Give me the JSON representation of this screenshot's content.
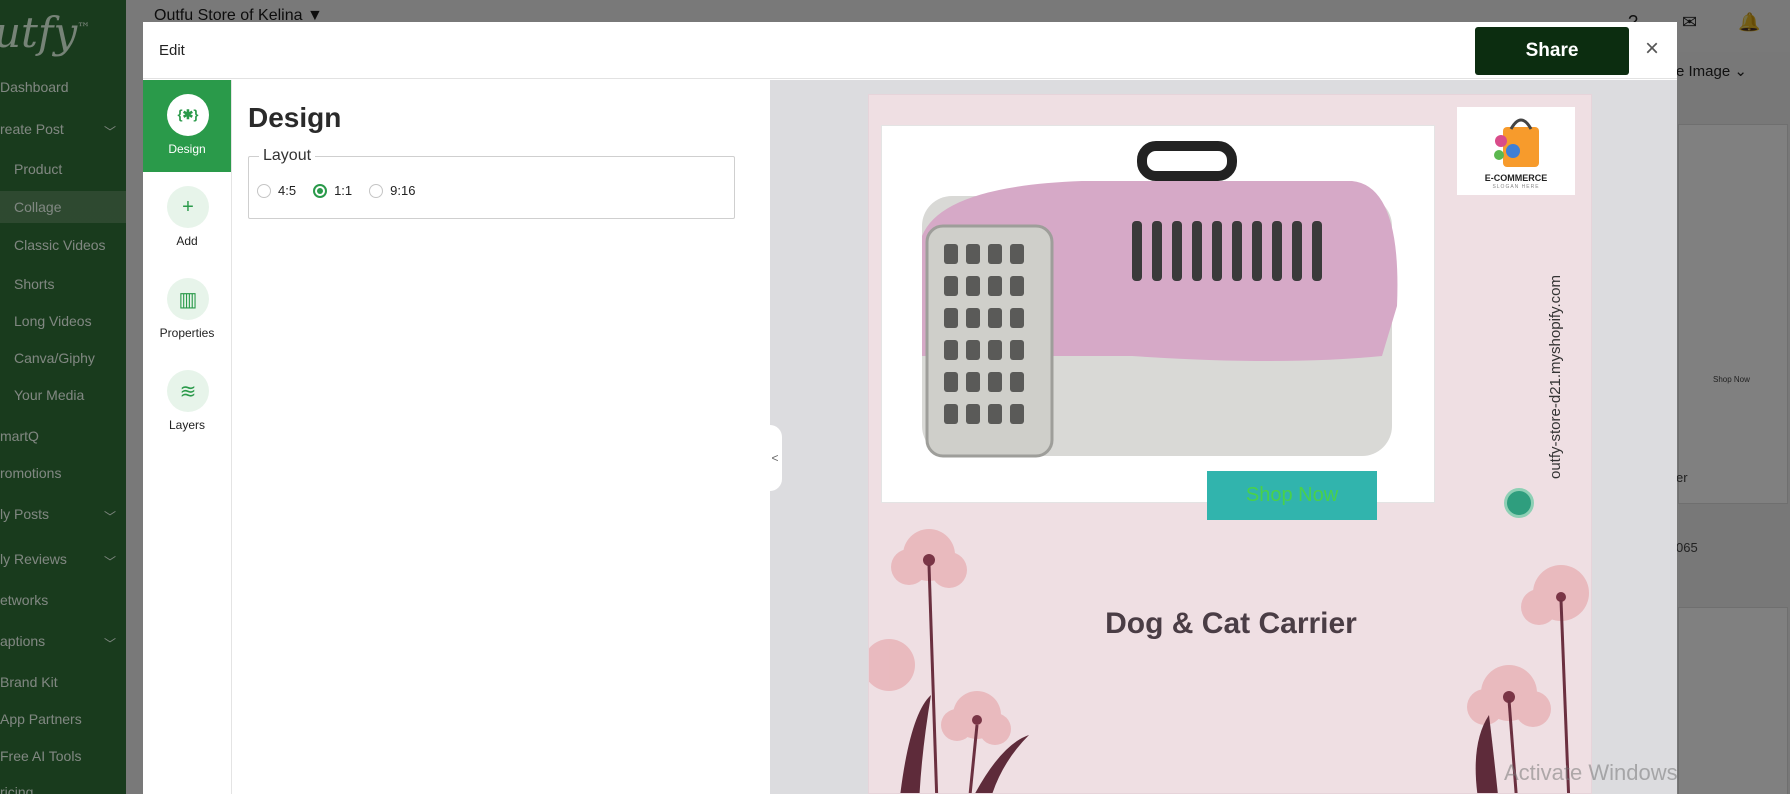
{
  "app": {
    "logo_text": "utfy",
    "logo_mark": "™",
    "store_selector": "Outfu Store of Kelina",
    "colors": {
      "brand_green": "#2a9a4a",
      "share_dark": "#0c2d10"
    }
  },
  "sidebar": {
    "items": [
      {
        "label": "Dashboard"
      },
      {
        "label": "reate Post"
      },
      {
        "label": "Product"
      },
      {
        "label": "Collage"
      },
      {
        "label": "Classic Videos"
      },
      {
        "label": "Shorts"
      },
      {
        "label": "Long Videos"
      },
      {
        "label": "Canva/Giphy"
      },
      {
        "label": "Your Media"
      },
      {
        "label": "martQ"
      },
      {
        "label": "romotions"
      },
      {
        "label": "ly Posts"
      },
      {
        "label": "ly Reviews"
      },
      {
        "label": "etworks"
      },
      {
        "label": "aptions"
      },
      {
        "label": "Brand Kit"
      },
      {
        "label": "App Partners"
      },
      {
        "label": "Free AI Tools"
      },
      {
        "label": "ricing"
      }
    ]
  },
  "background_right": {
    "dropdown_label": "e Image",
    "shop_now_small": "Shop Now",
    "snippet_1": "er",
    "snippet_2": "065"
  },
  "modal": {
    "title": "Edit",
    "share_label": "Share",
    "close_icon": "×",
    "tools": [
      {
        "label": "Design",
        "icon": "{✱}"
      },
      {
        "label": "Add",
        "icon": "+"
      },
      {
        "label": "Properties",
        "icon": "▥"
      },
      {
        "label": "Layers",
        "icon": "≋"
      }
    ],
    "panel": {
      "title": "Design",
      "layout_legend": "Layout",
      "layout_options": [
        "4:5",
        "1:1",
        "9:16"
      ],
      "selected_layout": "1:1"
    },
    "collapse_glyph": "<",
    "preview": {
      "logo_line1": "E-COMMERCE",
      "logo_line2": "SLOGAN HERE",
      "store_url": "outfy-store-d21.myshopify.com",
      "shop_button": "Shop Now",
      "product_title": "Dog & Cat Carrier"
    }
  },
  "os_watermark": "Activate Windows"
}
